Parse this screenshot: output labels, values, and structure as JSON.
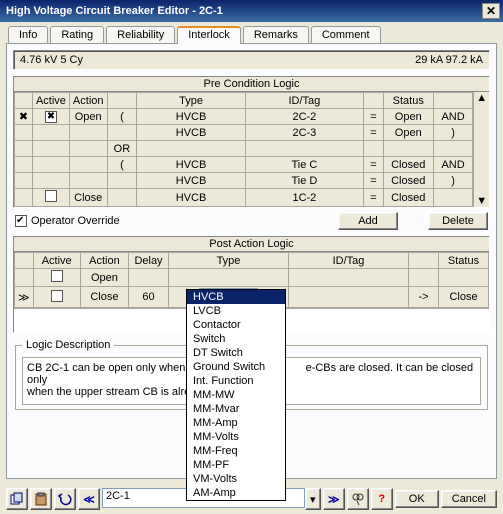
{
  "window": {
    "title": "High Voltage Circuit Breaker Editor - 2C-1"
  },
  "tabs": [
    "Info",
    "Rating",
    "Reliability",
    "Interlock",
    "Remarks",
    "Comment"
  ],
  "active_tab": "Interlock",
  "ratings": {
    "left": "4.76 kV  5 Cy",
    "right": "29 kA   97.2 kA"
  },
  "pre_logic": {
    "title": "Pre Condition Logic",
    "headers": [
      "Active",
      "Action",
      "",
      "Type",
      "ID/Tag",
      "",
      "Status",
      ""
    ],
    "rows": [
      {
        "rowhdr": "✖",
        "active": "☒",
        "action": "Open",
        "paren": "(",
        "type": "HVCB",
        "idtag": "2C-2",
        "op": "=",
        "status": "Open",
        "logic": "AND"
      },
      {
        "rowhdr": "",
        "active": "",
        "action": "",
        "paren": "",
        "type": "HVCB",
        "idtag": "2C-3",
        "op": "=",
        "status": "Open",
        "logic": ")"
      },
      {
        "rowhdr": "",
        "active": "",
        "action": "",
        "paren": "OR",
        "type": "",
        "idtag": "",
        "op": "",
        "status": "",
        "logic": ""
      },
      {
        "rowhdr": "",
        "active": "",
        "action": "",
        "paren": "(",
        "type": "HVCB",
        "idtag": "Tie C",
        "op": "=",
        "status": "Closed",
        "logic": "AND"
      },
      {
        "rowhdr": "",
        "active": "",
        "action": "",
        "paren": "",
        "type": "HVCB",
        "idtag": "Tie D",
        "op": "=",
        "status": "Closed",
        "logic": ")"
      },
      {
        "rowhdr": "",
        "active": "☐",
        "action": "Close",
        "paren": "",
        "type": "HVCB",
        "idtag": "1C-2",
        "op": "=",
        "status": "Closed",
        "logic": ""
      }
    ]
  },
  "operator_override": "Operator Override",
  "buttons": {
    "add": "Add",
    "delete": "Delete",
    "ok": "OK",
    "cancel": "Cancel"
  },
  "post_logic": {
    "title": "Post Action Logic",
    "headers": [
      "Active",
      "Action",
      "Delay",
      "Type",
      "ID/Tag",
      "",
      "Status"
    ],
    "rows": [
      {
        "rowhdr": "",
        "active": "☐",
        "action": "Open",
        "delay": "",
        "type": "",
        "idtag": "",
        "op": "",
        "status": ""
      },
      {
        "rowhdr": "≫",
        "active": "☐",
        "action": "Close",
        "delay": "60",
        "type": "HVCB",
        "idtag": "",
        "op": "->",
        "status": "Close"
      }
    ]
  },
  "dropdown_options": [
    "HVCB",
    "LVCB",
    "Contactor",
    "Switch",
    "DT Switch",
    "Ground Switch",
    "Int. Function",
    "MM-MW",
    "MM-Mvar",
    "MM-Amp",
    "MM-Volts",
    "MM-Freq",
    "MM-PF",
    "VM-Volts",
    "AM-Amp"
  ],
  "dropdown_selected": "HVCB",
  "logic_desc": {
    "title": "Logic Description",
    "text_part1": "CB 2C-1 can be open only when all",
    "text_part2": "e-CBs are closed. It can be closed only",
    "text_part3": "when the upper stream CB is alread"
  },
  "nav": {
    "current": "2C-1"
  }
}
